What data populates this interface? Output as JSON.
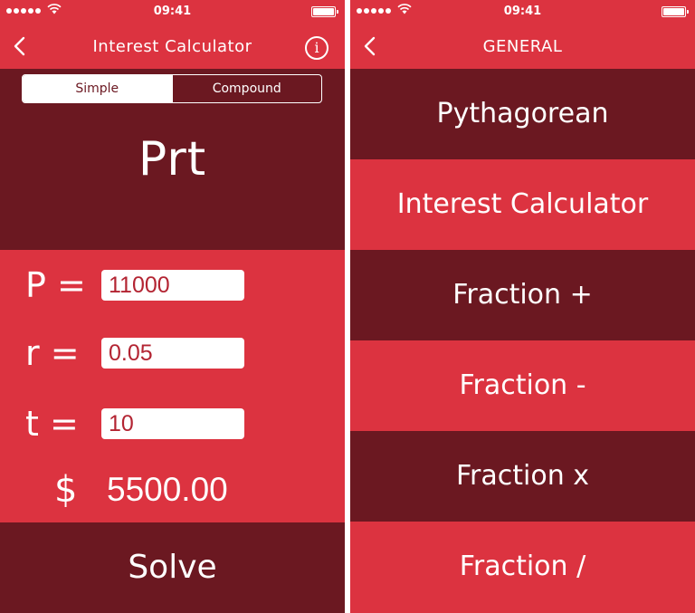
{
  "status_bar": {
    "time": "09:41"
  },
  "interest_screen": {
    "nav_title": "Interest Calculator",
    "segments": [
      {
        "label": "Simple",
        "selected": true
      },
      {
        "label": "Compound",
        "selected": false
      }
    ],
    "formula": "Prt",
    "fields": [
      {
        "label": "P =",
        "value": "11000"
      },
      {
        "label": "r =",
        "value": "0.05"
      },
      {
        "label": "t =",
        "value": "10"
      }
    ],
    "result_symbol": "$",
    "result_value": "5500.00",
    "solve_label": "Solve"
  },
  "general_screen": {
    "nav_title": "GENERAL",
    "items": [
      "Pythagorean",
      "Interest Calculator",
      "Fraction +",
      "Fraction -",
      "Fraction x",
      "Fraction /"
    ]
  },
  "icons": {
    "back": "chevron-left-icon",
    "info": "info-icon",
    "wifi": "wifi-icon",
    "battery": "battery-icon",
    "signal": "signal-dots-icon"
  },
  "colors": {
    "primary_red": "#DC3340",
    "dark_red": "#6B1821",
    "text_white": "#FFFFFF",
    "input_text": "#B32432"
  }
}
